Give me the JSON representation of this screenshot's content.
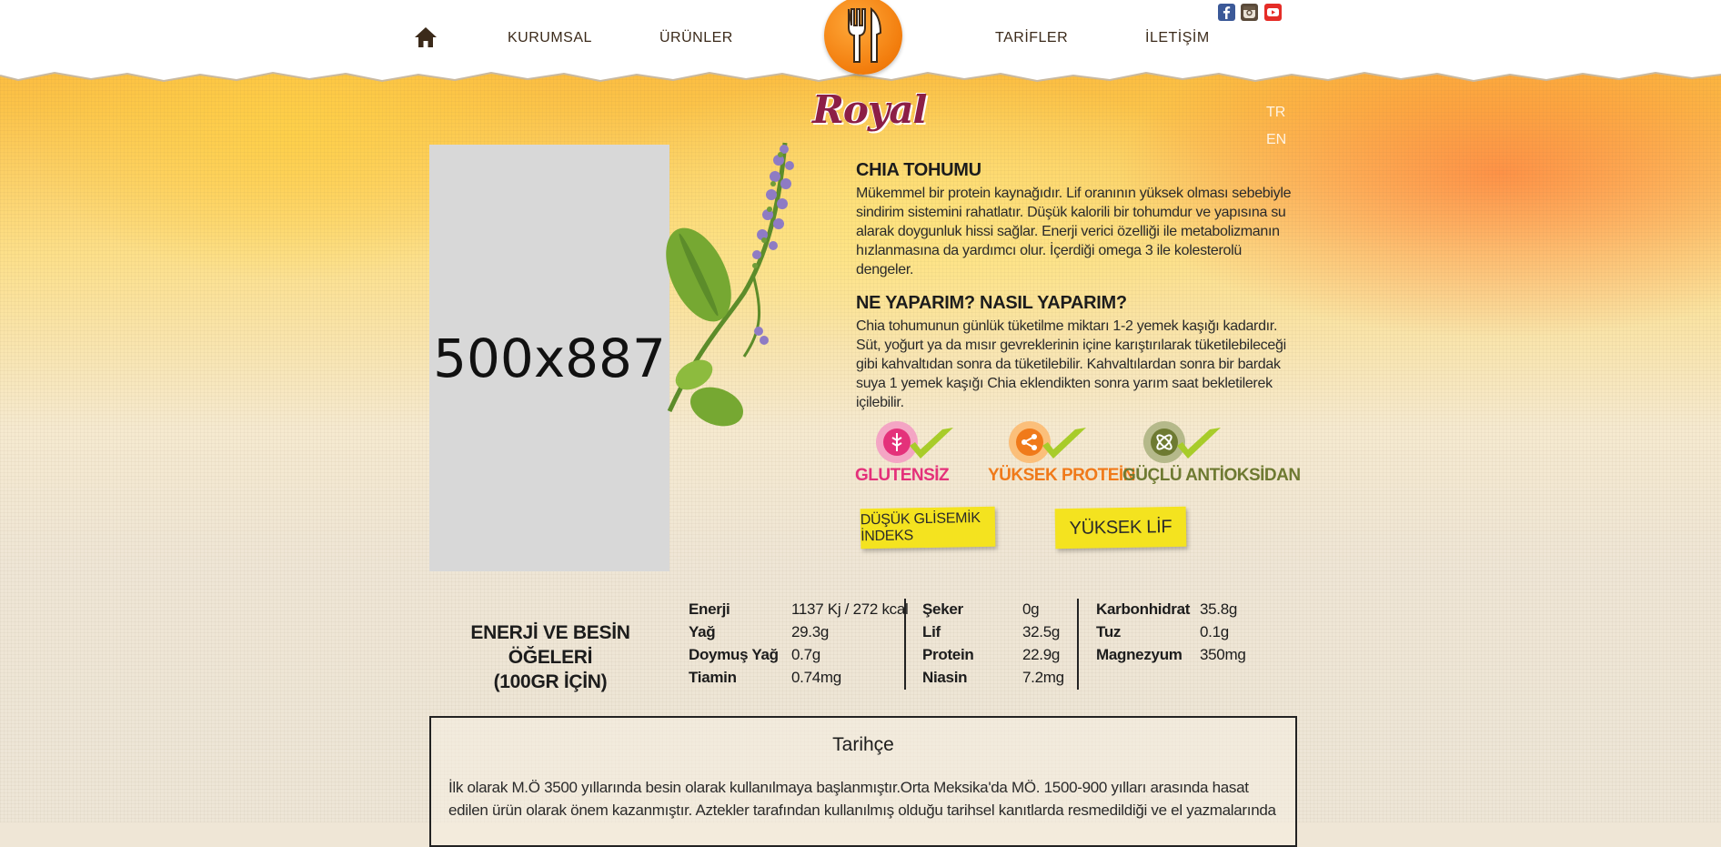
{
  "nav": {
    "home_icon": "home-icon",
    "items": [
      "KURUMSAL",
      "ÜRÜNLER",
      "TARİFLER",
      "İLETİŞİM"
    ],
    "logo_word": "Royal"
  },
  "social": [
    {
      "name": "facebook-icon",
      "color": "#3b5998"
    },
    {
      "name": "instagram-icon",
      "color": "#5a4a3a"
    },
    {
      "name": "youtube-icon",
      "color": "#e52d27"
    }
  ],
  "languages": [
    "TR",
    "EN"
  ],
  "product": {
    "image_placeholder": "500x887",
    "title": "CHIA TOHUMU",
    "description": "Mükemmel bir protein kaynağıdır. Lif oranının yüksek olması sebebiyle sindirim sistemini rahatlatır. Düşük kalorili bir tohumdur ve yapısına su alarak  doygunluk hissi sağlar. Enerji verici özelliği ile metabolizmanın hızlanmasına da  yardımcı olur. İçerdiği omega 3 ile kolesterolü dengeler.",
    "usage_title": "NE YAPARIM? NASIL YAPARIM?",
    "usage_text": "Chia tohumunun günlük tüketilme miktarı 1-2 yemek kaşığı kadardır. Süt, yoğurt ya da mısır gevreklerinin içine karıştırılarak tüketilebileceği gibi kahvaltıdan sonra da tüketilebilir. Kahvaltılardan sonra bir bardak suya 1 yemek kaşığı  Chia eklendikten sonra  yarım saat bekletilerek içilebilir."
  },
  "badges": [
    {
      "label": "GLUTENSİZ",
      "color": "#e4317a"
    },
    {
      "label": "YÜKSEK PROTEİN",
      "color": "#f07a1a"
    },
    {
      "label": "GÜÇLÜ ANTİOKSİDAN",
      "color": "#6e7a32"
    }
  ],
  "banners": [
    "DÜŞÜK GLİSEMİK İNDEKS",
    "YÜKSEK LİF"
  ],
  "nutrition": {
    "heading_line1": "ENERJİ VE BESİN ÖĞELERİ",
    "heading_line2": "(100GR İÇİN)",
    "col1": [
      {
        "label": "Enerji",
        "value": "1137 Kj / 272 kcal"
      },
      {
        "label": "Yağ",
        "value": "29.3g"
      },
      {
        "label": "Doymuş Yağ",
        "value": "0.7g"
      },
      {
        "label": "Tiamin",
        "value": "0.74mg"
      }
    ],
    "col2": [
      {
        "label": "Şeker",
        "value": "0g"
      },
      {
        "label": "Lif",
        "value": "32.5g"
      },
      {
        "label": "Protein",
        "value": "22.9g"
      },
      {
        "label": "Niasin",
        "value": "7.2mg"
      }
    ],
    "col3": [
      {
        "label": "Karbonhidrat",
        "value": "35.8g"
      },
      {
        "label": "Tuz",
        "value": "0.1g"
      },
      {
        "label": "Magnezyum",
        "value": "350mg"
      }
    ]
  },
  "history": {
    "title": "Tarihçe",
    "text": "İlk olarak M.Ö 3500 yıllarında besin olarak kullanılmaya başlanmıştır.Orta Meksika'da MÖ. 1500-900 yılları arasında hasat edilen ürün olarak önem kazanmıştır. Aztekler tarafından kullanılmış olduğu tarihsel kanıtlarda resmedildiği ve el yazmalarında"
  },
  "colors": {
    "nav_text": "#3b2a1a",
    "logo_orange": "#f27c0c",
    "logo_word": "#8c1f46",
    "banner_yellow": "#f4e31f"
  }
}
